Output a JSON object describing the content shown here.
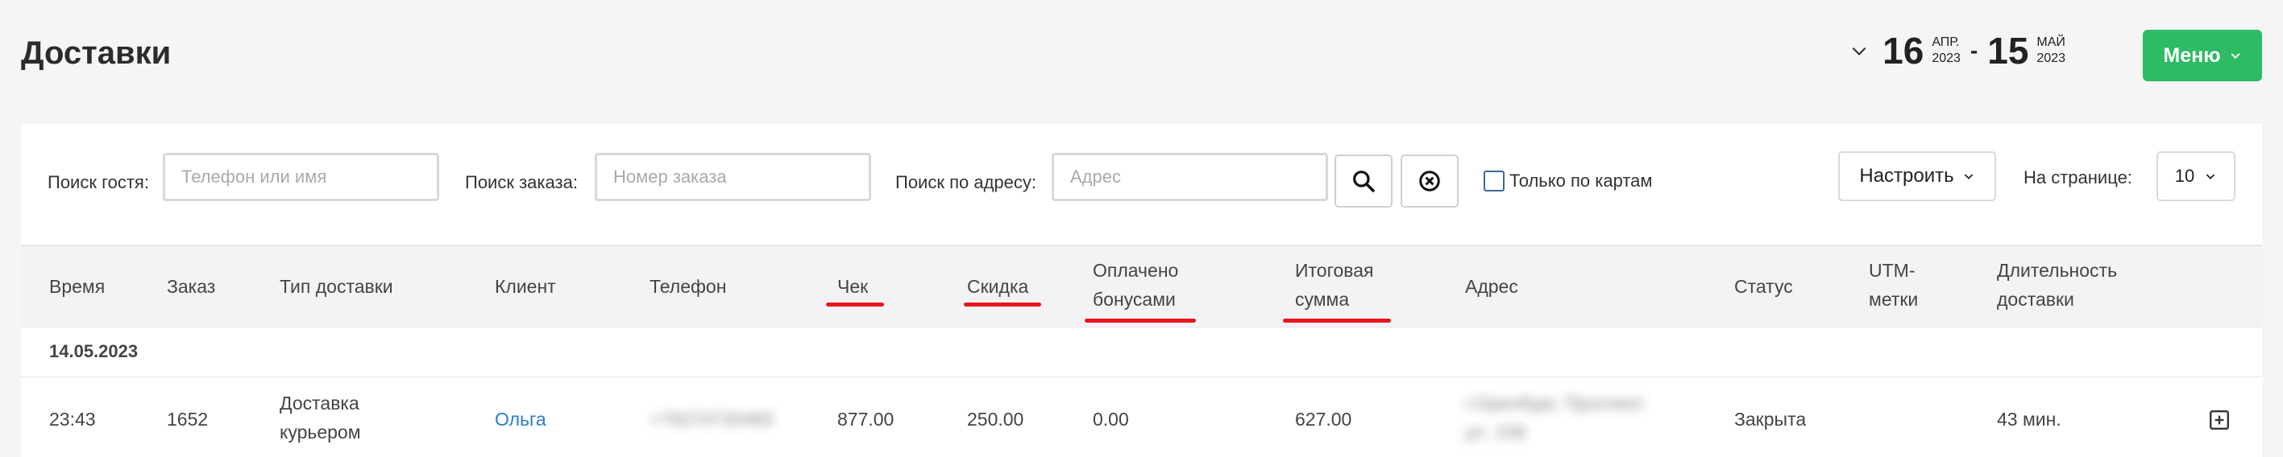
{
  "page": {
    "title": "Доставки"
  },
  "date_range": {
    "from_day": "16",
    "from_month": "АПР.",
    "from_year": "2023",
    "separator": "-",
    "to_day": "15",
    "to_month": "МАЙ",
    "to_year": "2023"
  },
  "menu": {
    "label": "Меню"
  },
  "filters": {
    "guest_label": "Поиск гостя:",
    "guest_placeholder": "Телефон или имя",
    "order_label": "Поиск заказа:",
    "order_placeholder": "Номер заказа",
    "address_label": "Поиск по адресу:",
    "address_placeholder": "Адрес",
    "only_cards_label": "Только по картам",
    "settings_label": "Настроить",
    "per_page_label": "На странице:",
    "per_page_value": "10"
  },
  "table": {
    "headers": {
      "time": "Время",
      "order": "Заказ",
      "delivery_type": "Тип доставки",
      "client": "Клиент",
      "phone": "Телефон",
      "check": "Чек",
      "discount": "Скидка",
      "paid_bonus_1": "Оплачено",
      "paid_bonus_2": "бонусами",
      "total_1": "Итоговая",
      "total_2": "сумма",
      "address": "Адрес",
      "status": "Статус",
      "utm_1": "UTM-",
      "utm_2": "метки",
      "duration_1": "Длительность",
      "duration_2": "доставки"
    },
    "group_date": "14.05.2023",
    "row": {
      "time": "23:43",
      "order": "1652",
      "delivery_type_1": "Доставка",
      "delivery_type_2": "курьером",
      "client": "Ольга",
      "phone": "+79270730465",
      "check": "877.00",
      "discount": "250.00",
      "paid_bonus": "0.00",
      "total": "627.00",
      "address_1": "г.Оренбург, Проспект",
      "address_2": "ул. 238",
      "status": "Закрыта",
      "duration": "43 мин."
    }
  },
  "colors": {
    "accent": "#2dbb63",
    "link": "#2a7cc4",
    "annotation": "#e8161c"
  }
}
